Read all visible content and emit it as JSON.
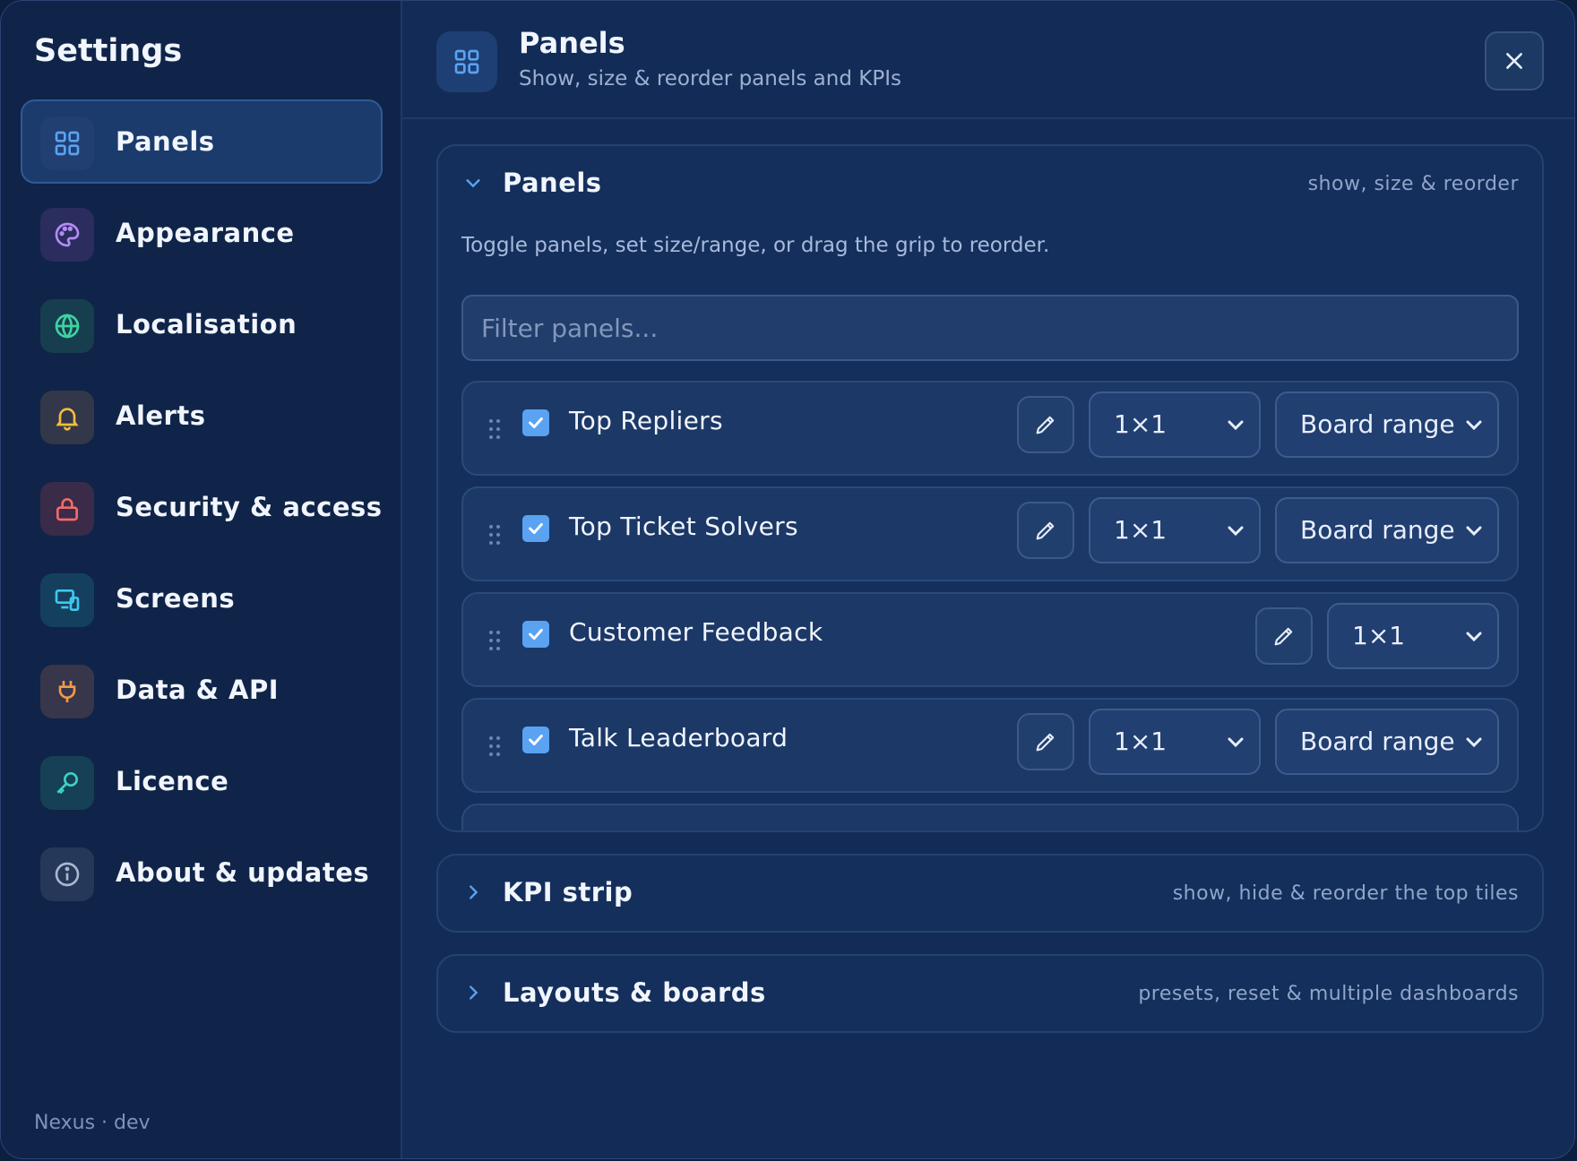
{
  "sidebar": {
    "title": "Settings",
    "items": [
      {
        "label": "Panels",
        "icon": "grid-icon",
        "color": "#5aa2f2"
      },
      {
        "label": "Appearance",
        "icon": "palette-icon",
        "color": "#b58af5"
      },
      {
        "label": "Localisation",
        "icon": "globe-icon",
        "color": "#3fd2a0"
      },
      {
        "label": "Alerts",
        "icon": "bell-icon",
        "color": "#f3bd3c"
      },
      {
        "label": "Security & access",
        "icon": "lock-icon",
        "color": "#f26a6a"
      },
      {
        "label": "Screens",
        "icon": "devices-icon",
        "color": "#3ec8f0"
      },
      {
        "label": "Data & API",
        "icon": "plug-icon",
        "color": "#f39a4a"
      },
      {
        "label": "Licence",
        "icon": "key-icon",
        "color": "#3fd2c4"
      },
      {
        "label": "About & updates",
        "icon": "info-icon",
        "color": "#a9b6cc"
      }
    ],
    "footer": "Nexus · dev"
  },
  "header": {
    "title": "Panels",
    "subtitle": "Show, size & reorder panels and KPIs"
  },
  "panels_section": {
    "title": "Panels",
    "hint": "show, size & reorder",
    "description": "Toggle panels, set size/range, or drag the grip to reorder.",
    "filter_placeholder": "Filter panels...",
    "rows": [
      {
        "label": "Top Repliers",
        "checked": true,
        "size": "1×1",
        "range": "Board range"
      },
      {
        "label": "Top Ticket Solvers",
        "checked": true,
        "size": "1×1",
        "range": "Board range"
      },
      {
        "label": "Customer Feedback",
        "checked": true,
        "size": "1×1",
        "range": null
      },
      {
        "label": "Talk Leaderboard",
        "checked": true,
        "size": "1×1",
        "range": "Board range"
      }
    ]
  },
  "kpi_section": {
    "title": "KPI strip",
    "hint": "show, hide & reorder the top tiles"
  },
  "layouts_section": {
    "title": "Layouts & boards",
    "hint": "presets, reset & multiple dashboards"
  },
  "colors": {
    "accent": "#5aa2f2",
    "background": "#132c57",
    "sidebar": "#0f2448"
  }
}
